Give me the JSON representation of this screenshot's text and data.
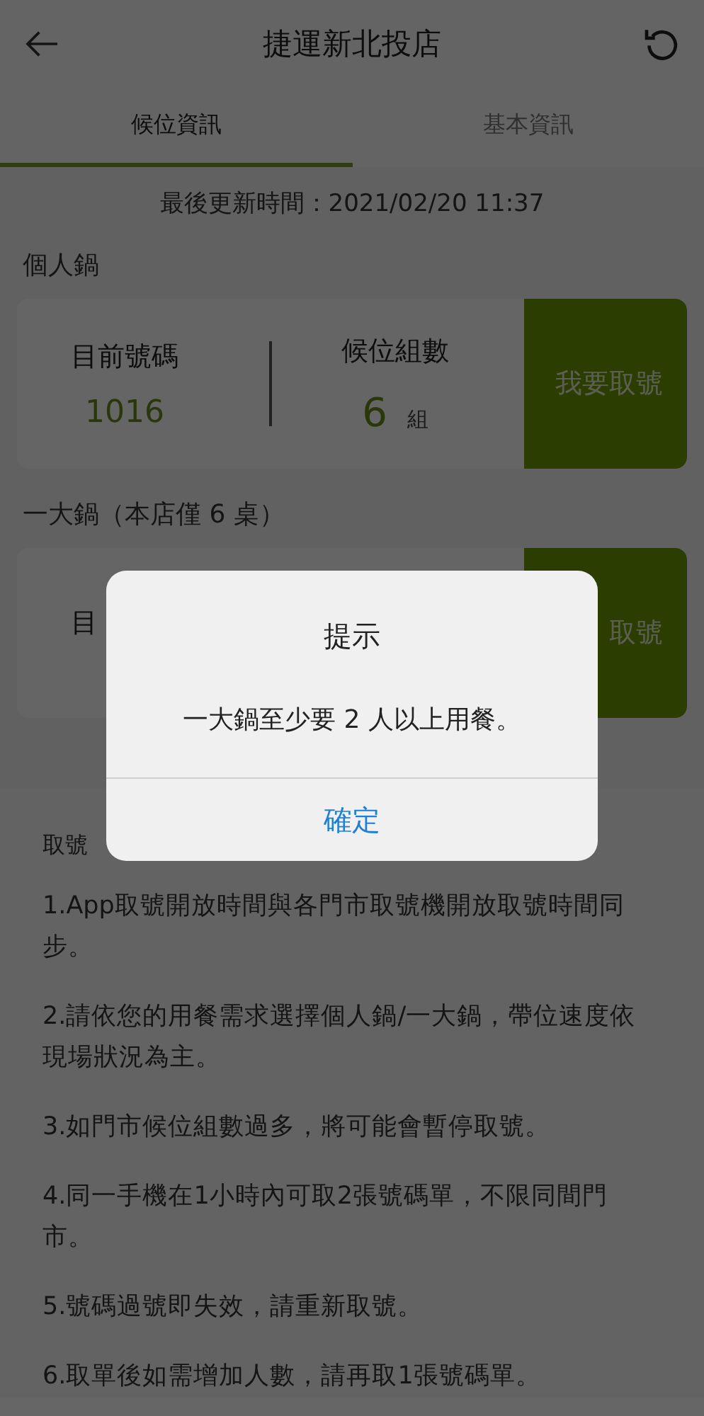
{
  "header": {
    "title": "捷運新北投店"
  },
  "tabs": [
    {
      "label": "候位資訊",
      "selected": true
    },
    {
      "label": "基本資訊",
      "selected": false
    }
  ],
  "last_updated": "最後更新時間：2021/02/20 11:37",
  "sections": [
    {
      "heading": "個人鍋",
      "card": {
        "stats": [
          {
            "label": "目前號碼",
            "value": "1016"
          },
          {
            "label": "候位組數",
            "value": "6",
            "unit": "組"
          }
        ],
        "button": "我要取號"
      }
    },
    {
      "heading": "一大鍋（本店僅 6 桌）",
      "card": {
        "stats": [
          {
            "label": "目"
          }
        ],
        "button": "取號"
      }
    }
  ],
  "notes": {
    "heading": "取號",
    "items": [
      "1.App取號開放時間與各門市取號機開放取號時間同步。",
      "2.請依您的用餐需求選擇個人鍋/一大鍋，帶位速度依現場狀況為主。",
      "3.如門市候位組數過多，將可能會暫停取號。",
      "4.同一手機在1小時內可取2張號碼單，不限同間門市。",
      "5.號碼過號即失效，請重新取號。",
      "6.取單後如需增加人數，請再取1張號碼單。"
    ]
  },
  "dialog": {
    "title": "提示",
    "message": "一大鍋至少要 2 人以上用餐。",
    "button": "確定"
  }
}
